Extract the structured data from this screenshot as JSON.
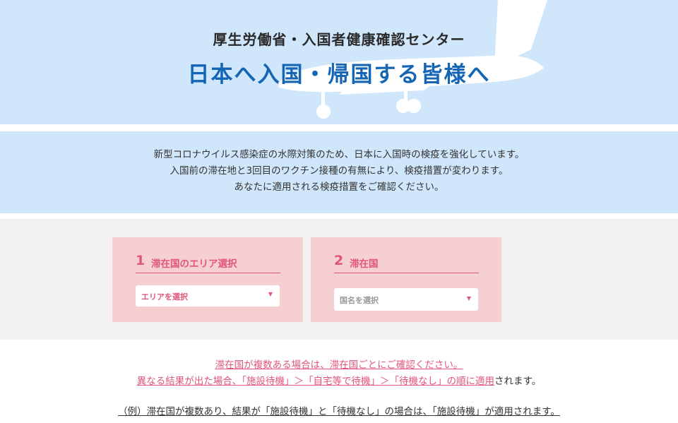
{
  "header": {
    "subtitle": "厚生労働省・入国者健康確認センター",
    "title": "日本へ入国・帰国する皆様へ"
  },
  "intro": {
    "lines": [
      "新型コロナウイルス感染症の水際対策のため、日本に入国時の検疫を強化しています。",
      "入国前の滞在地と3回目のワクチン接種の有無により、検疫措置が変わります。",
      "あなたに適用される検疫措置をご確認ください。"
    ]
  },
  "steps": [
    {
      "number": "1",
      "label": "滞在国のエリア選択",
      "select_value": "エリアを選択"
    },
    {
      "number": "2",
      "label": "滞在国",
      "select_value": "国名を選択"
    }
  ],
  "notes": {
    "line1": "滞在国が複数ある場合は、滞在国ごとにご確認ください。",
    "line2_link": "異なる結果が出た場合、「施設待機」＞「自宅等で待機」＞「待機なし」の順に適用",
    "line2_rest": "されます。",
    "example": "（例）滞在国が複数あり、結果が「施設待機」と「待機なし」の場合は、「施設待機」が適用されます。"
  },
  "colors": {
    "hero_bg": "#cfe6fb",
    "title_blue": "#1565b5",
    "accent_pink": "#e0567a",
    "panel_pink": "#f6cfd3",
    "band_gray": "#f1f1f1"
  }
}
